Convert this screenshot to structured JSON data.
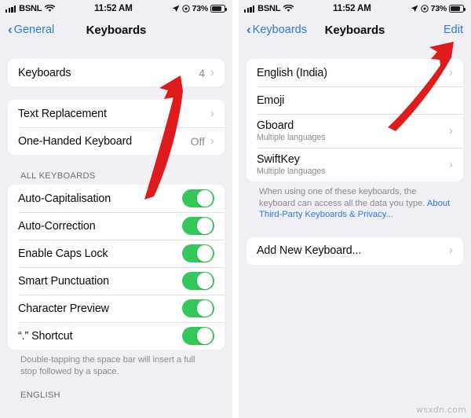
{
  "status_bar": {
    "carrier": "BSNL",
    "time": "11:52 AM",
    "battery_percent": "73%",
    "signal_icon": "signal-bars-icon",
    "wifi_icon": "wifi-icon",
    "location_icon": "location-arrow-icon",
    "alarm_icon": "alarm-clock-icon",
    "battery_icon": "battery-icon"
  },
  "left_screen": {
    "nav": {
      "back_label": "General",
      "title": "Keyboards"
    },
    "keyboards_row": {
      "label": "Keyboards",
      "value": "4"
    },
    "options_rows": [
      {
        "label": "Text Replacement",
        "value": ""
      },
      {
        "label": "One-Handed Keyboard",
        "value": "Off"
      }
    ],
    "all_keyboards_header": "ALL KEYBOARDS",
    "toggles": [
      {
        "label": "Auto-Capitalisation",
        "on": true
      },
      {
        "label": "Auto-Correction",
        "on": true
      },
      {
        "label": "Enable Caps Lock",
        "on": true
      },
      {
        "label": "Smart Punctuation",
        "on": true
      },
      {
        "label": "Character Preview",
        "on": true
      },
      {
        "label": "“.” Shortcut",
        "on": true
      }
    ],
    "footnote": "Double-tapping the space bar will insert a full stop followed by a space.",
    "english_header": "ENGLISH"
  },
  "right_screen": {
    "nav": {
      "back_label": "Keyboards",
      "title": "Keyboards",
      "edit_label": "Edit"
    },
    "keyboard_list": [
      {
        "name": "English (India)",
        "subtitle": "",
        "chevron": true
      },
      {
        "name": "Emoji",
        "subtitle": "",
        "chevron": false
      },
      {
        "name": "Gboard",
        "subtitle": "Multiple languages",
        "chevron": true
      },
      {
        "name": "SwiftKey",
        "subtitle": "Multiple languages",
        "chevron": true
      }
    ],
    "footnote_text": "When using one of these keyboards, the keyboard can access all the data you type. ",
    "footnote_link": "About Third-Party Keyboards & Privacy...",
    "add_row": {
      "label": "Add New Keyboard..."
    }
  },
  "annotations": {
    "arrow_color": "#E01B1B",
    "arrow_left_name": "red-arrow-pointing-to-keyboards-count",
    "arrow_right_name": "red-arrow-pointing-to-edit-button"
  },
  "watermark": "wsxdn.com",
  "colors": {
    "page_background": "#EFEFF4",
    "card_background": "#FFFFFF",
    "accent_blue": "#2F7BD6",
    "toggle_green": "#34C759",
    "secondary_text": "#8A8A8E"
  }
}
